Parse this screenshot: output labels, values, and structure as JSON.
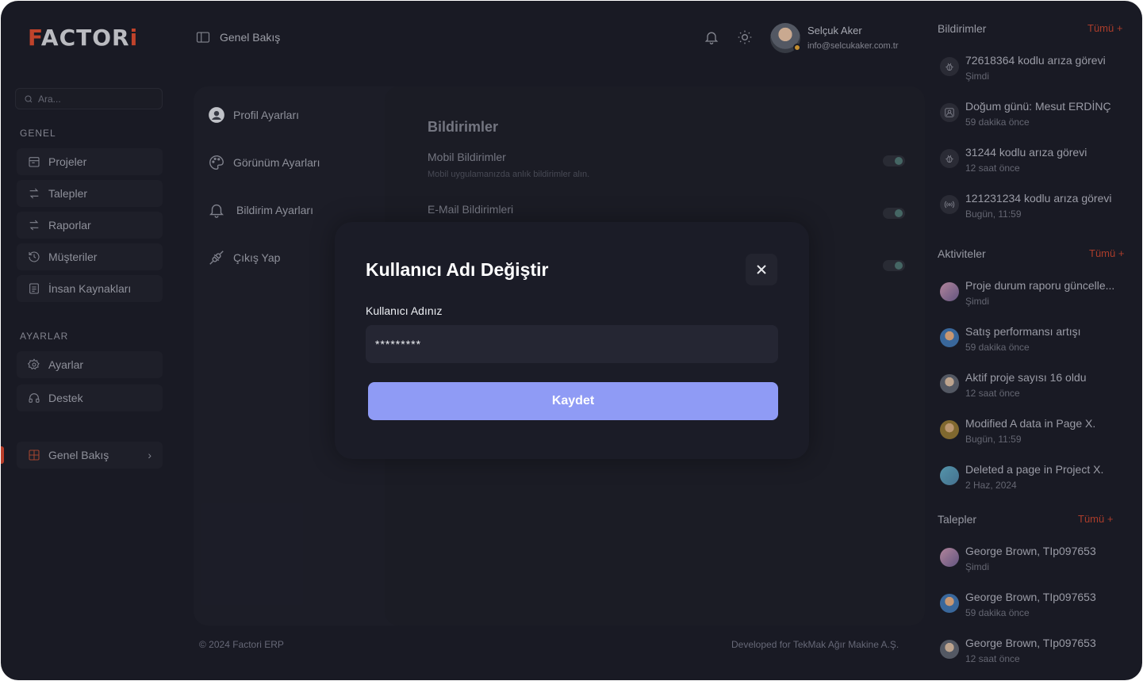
{
  "app": {
    "logo_text": "FACTORi"
  },
  "search": {
    "placeholder": "Ara..."
  },
  "sidebar": {
    "general_label": "GENEL",
    "general_items": [
      {
        "label": "Projeler",
        "icon": "calendar-icon"
      },
      {
        "label": "Talepler",
        "icon": "arrows-swap-icon"
      },
      {
        "label": "Raporlar",
        "icon": "arrows-swap-icon"
      },
      {
        "label": "Müşteriler",
        "icon": "history-icon"
      },
      {
        "label": "İnsan Kaynakları",
        "icon": "document-icon"
      }
    ],
    "settings_label": "AYARLAR",
    "settings_items": [
      {
        "label": "Ayarlar",
        "icon": "gear-icon"
      },
      {
        "label": "Destek",
        "icon": "headset-icon"
      }
    ],
    "overview": {
      "label": "Genel Bakış",
      "icon": "grid-icon",
      "accent": "#c9432d"
    }
  },
  "header": {
    "title": "Genel Bakış",
    "user_name": "Selçuk Aker",
    "user_email": "info@selcukaker.com.tr"
  },
  "settings_nav": [
    {
      "label": "Profil Ayarları",
      "icon": "user-circle-icon"
    },
    {
      "label": "Görünüm Ayarları",
      "icon": "palette-icon"
    },
    {
      "label": "Bildirim Ayarları",
      "icon": "bell-icon"
    },
    {
      "label": "Çıkış Yap",
      "icon": "unplug-icon"
    }
  ],
  "notifications_panel": {
    "title": "Bildirimler",
    "options": [
      {
        "label": "Mobil Bildirimler",
        "description": "Mobil uygulamanızda anlık bildirimler alın.",
        "enabled": true
      },
      {
        "label": "E-Mail Bildirimleri",
        "enabled": true
      },
      {
        "enabled": true
      }
    ]
  },
  "footer": {
    "left": "© 2024 Factori ERP",
    "right": "Developed for TekMak Ağır Makine A.Ş."
  },
  "right_panel": {
    "notifications": {
      "title": "Bildirimler",
      "all_label": "Tümü +",
      "items": [
        {
          "title": "72618364 kodlu arıza görevi",
          "time": "Şimdi",
          "icon": "bug-icon"
        },
        {
          "title": "Doğum günü: Mesut ERDİNÇ",
          "time": "59 dakika önce",
          "icon": "user-icon"
        },
        {
          "title": "31244 kodlu arıza görevi",
          "time": "12 saat önce",
          "icon": "bug-icon"
        },
        {
          "title": "121231234 kodlu arıza görevi",
          "time": "Bugün, 11:59",
          "icon": "broadcast-icon"
        }
      ]
    },
    "activities": {
      "title": "Aktiviteler",
      "all_label": "Tümü +",
      "items": [
        {
          "title": "Proje durum raporu güncelle...",
          "time": "Şimdi"
        },
        {
          "title": "Satış performansı artışı",
          "time": "59 dakika önce"
        },
        {
          "title": "Aktif proje sayısı 16 oldu",
          "time": "12 saat önce"
        },
        {
          "title": "Modified A data in Page X.",
          "time": "Bugün, 11:59"
        },
        {
          "title": "Deleted a page in Project X.",
          "time": "2 Haz, 2024"
        }
      ]
    },
    "requests": {
      "title": "Talepler",
      "all_label": "Tümü +",
      "items": [
        {
          "title": "George Brown, TIp097653",
          "time": "Şimdi"
        },
        {
          "title": "George Brown, TIp097653",
          "time": "59 dakika önce"
        },
        {
          "title": "George Brown, TIp097653",
          "time": "12 saat önce"
        }
      ]
    }
  },
  "modal": {
    "title": "Kullanıcı Adı Değiştir",
    "field_label": "Kullanıcı Adınız",
    "field_value": "*********",
    "save_label": "Kaydet",
    "button_color": "#8f9bf5"
  }
}
